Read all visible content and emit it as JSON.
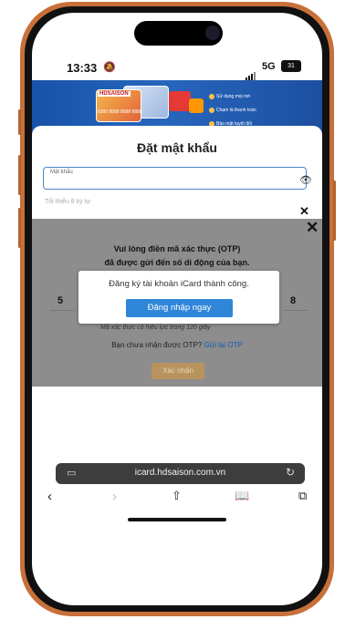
{
  "status_bar": {
    "time": "13:33",
    "network": "5G",
    "battery": "31"
  },
  "banner": {
    "card_brand": "HDSAISON",
    "card_number": "6200 8888 8888 8888",
    "features": [
      "Sử dụng mọi nơi",
      "Chạm là thanh toán",
      "Bảo mật tuyệt đối"
    ]
  },
  "form": {
    "title": "Đặt mật khẩu",
    "password_label": "Mật khẩu",
    "faded_text": "Tối thiểu 8 ký tự",
    "eye_icon": "eye-slash-icon"
  },
  "otp": {
    "title_line1": "Vui lòng điền mã xác thực (OTP)",
    "title_line2": "đã được gửi đến số di động của bạn.",
    "digit_first": "5",
    "digit_last": "8",
    "validity_note": "Mã xác thực có hiệu lực trong 120 giây",
    "resend_prefix": "Bạn chưa nhận được OTP?",
    "resend_link": "Gửi lại OTP",
    "confirm_label": "Xác nhận"
  },
  "dialog": {
    "message": "Đăng ký tài khoản iCard thành công.",
    "button_label": "Đăng nhập ngay"
  },
  "browser": {
    "url": "icard.hdsaison.com.vn",
    "toolbar_icons": [
      "back-icon",
      "forward-icon",
      "share-icon",
      "bookmarks-icon",
      "tabs-icon"
    ]
  },
  "colors": {
    "frame": "#c8703a",
    "primary_blue": "#2f86d8",
    "overlay": "#8d8d8d",
    "confirm_gold": "#b8935d"
  }
}
